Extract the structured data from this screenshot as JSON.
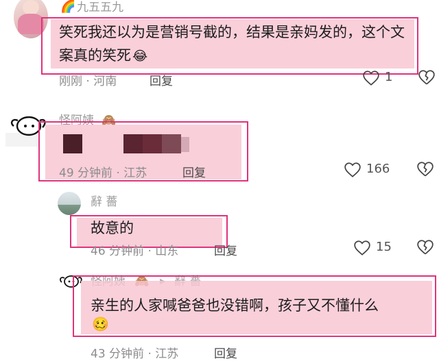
{
  "comments": [
    {
      "username": "九五五九",
      "text": "笑死我还以为是营销号截的，结果是亲妈发的，这个文案真的笑死",
      "emoji": "😂",
      "time": "刚刚",
      "location": "河南",
      "reply_label": "回复",
      "likes": "1",
      "like_icon": "heart-outline-icon",
      "dislike_icon": "broken-heart-icon"
    },
    {
      "username": "怪阿姨",
      "badge_emoji": "🙈",
      "time": "49 分钟前",
      "location": "江苏",
      "reply_label": "回复",
      "likes": "166",
      "pixelated": true
    },
    {
      "username": "辭 薔",
      "text": "故意的",
      "time": "46 分钟前",
      "location": "山东",
      "reply_label": "回复",
      "likes": "15"
    },
    {
      "username": "怪阿姨",
      "badge_emoji": "🙈",
      "reply_to": "辭 薔",
      "text": "亲生的人家喊爸爸也没错啊，孩子又不懂什么",
      "emoji": "🥴",
      "time": "43 分钟前",
      "location": "江苏",
      "reply_label": "回复"
    }
  ],
  "colors": {
    "highlight": "#f8c4d2",
    "frame": "#e0327a",
    "mosaic": [
      "#4a1f28",
      "#6b2c3a",
      "#7e4a55",
      "#a77a86"
    ]
  }
}
